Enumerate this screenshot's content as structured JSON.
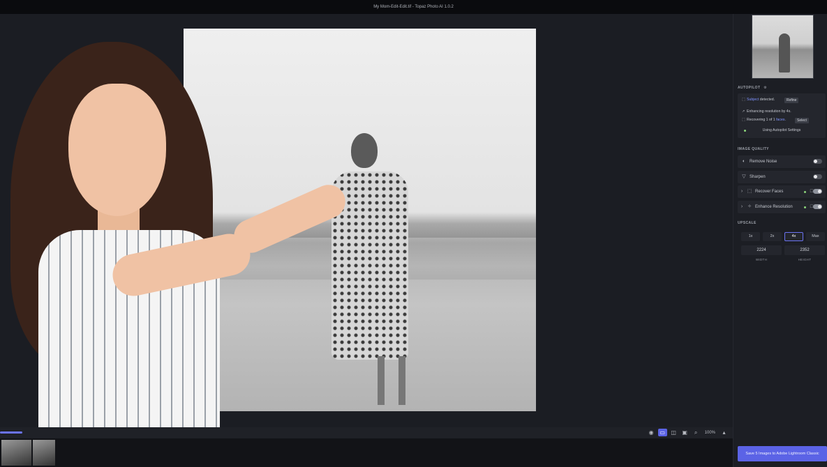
{
  "window": {
    "title": "My Mom-Edit-Edit.tif - Topaz Photo AI 1.0.2"
  },
  "autopilot": {
    "heading": "AUTOPILOT",
    "subject_word": "Subject",
    "subject_rest": " detected.",
    "refine_label": "Refine",
    "enhancing_text": "Enhancing resolution by 4x.",
    "recovering_prefix": "Recovering 1 of 1 ",
    "recovering_link": "faces",
    "recovering_suffix": ".",
    "select_label": "Select",
    "settings_text": "Using Autopilot Settings"
  },
  "image_quality": {
    "heading": "IMAGE QUALITY",
    "items": [
      {
        "label": "Remove Noise",
        "enabled": false
      },
      {
        "label": "Sharpen",
        "enabled": false
      },
      {
        "label": "Recover Faces",
        "enabled": true
      },
      {
        "label": "Enhance Resolution",
        "enabled": true
      }
    ]
  },
  "upscale": {
    "heading": "UPSCALE",
    "options": [
      "1x",
      "2x",
      "4x",
      "Max"
    ],
    "selected": "4x",
    "width_value": "2224",
    "height_value": "2352",
    "width_caption": "WIDTH",
    "height_caption": "HEIGHT"
  },
  "viewer": {
    "zoom_label": "100%"
  },
  "save": {
    "label": "Save 5 Images to Adobe Lightroom Classic"
  },
  "colors": {
    "accent": "#5b63e6",
    "panel": "#1c1e24",
    "canvas": "#1b1d23"
  }
}
